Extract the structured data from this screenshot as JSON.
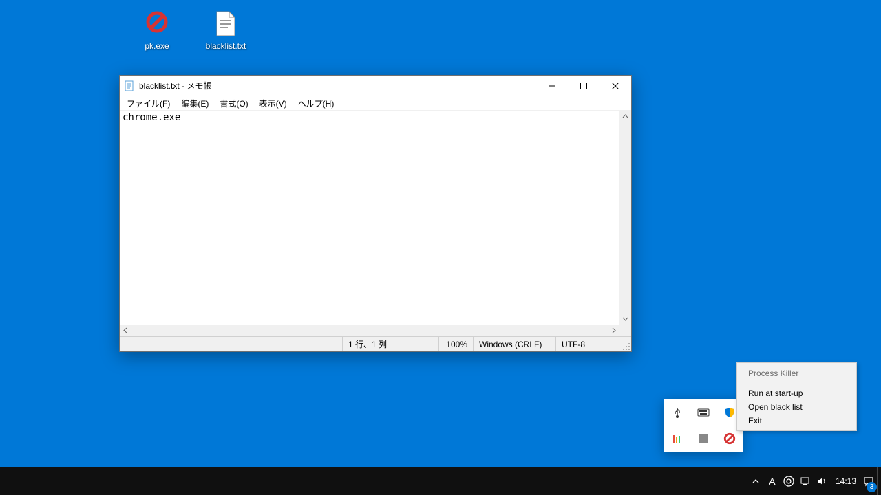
{
  "desktop": {
    "icons": [
      {
        "name": "pk.exe"
      },
      {
        "name": "blacklist.txt"
      }
    ]
  },
  "notepad": {
    "title": "blacklist.txt - メモ帳",
    "menus": {
      "file": "ファイル(F)",
      "edit": "編集(E)",
      "format": "書式(O)",
      "view": "表示(V)",
      "help": "ヘルプ(H)"
    },
    "content": "chrome.exe",
    "status": {
      "position": "1 行、1 列",
      "zoom": "100%",
      "line_ending": "Windows (CRLF)",
      "encoding": "UTF-8"
    }
  },
  "context_menu": {
    "title": "Process Killer",
    "items": {
      "startup": "Run at start-up",
      "open_blacklist": "Open black list",
      "exit": "Exit"
    }
  },
  "taskbar": {
    "clock": "14:13",
    "notification_count": "3"
  }
}
